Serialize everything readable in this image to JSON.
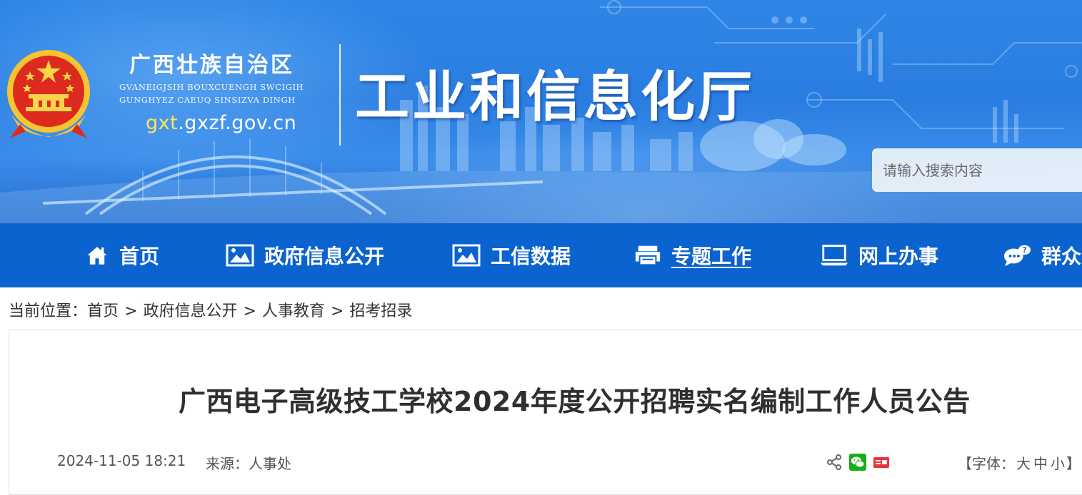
{
  "header": {
    "region_name_cn": "广西壮族自治区",
    "region_name_zhuang_line1": "GVANEIGJSIH BOUXCUENGH SWCIGIH",
    "region_name_zhuang_line2": "GUNGHYEZ CAEUQ SINSIZVA DINGH",
    "domain_prefix": "gxt",
    "domain_rest": ".gxzf.gov.cn",
    "department": "工业和信息化厅",
    "search_placeholder": "请输入搜索内容"
  },
  "nav": {
    "items": [
      {
        "label": "首页",
        "icon": "home-icon"
      },
      {
        "label": "政府信息公开",
        "icon": "picture-icon"
      },
      {
        "label": "工信数据",
        "icon": "picture-icon"
      },
      {
        "label": "专题工作",
        "icon": "printer-icon",
        "active": true
      },
      {
        "label": "网上办事",
        "icon": "monitor-icon"
      },
      {
        "label": "群众",
        "icon": "chat-icon"
      }
    ]
  },
  "breadcrumb": {
    "prefix": "当前位置：",
    "items": [
      "首页",
      "政府信息公开",
      "人事教育",
      "招考招录"
    ],
    "separator": ">"
  },
  "article": {
    "title": "广西电子高级技工学校2024年度公开招聘实名编制工作人员公告",
    "date": "2024-11-05 18:21",
    "source": "来源：人事处",
    "font_size": {
      "open": "【字体：",
      "large": "大",
      "medium": "中",
      "small": "小",
      "close": "】"
    }
  },
  "colors": {
    "nav_bg": "#0b63cf",
    "header_bg": "#2a7de0",
    "domain_highlight": "#ffe45c",
    "wechat": "#1aad19",
    "toutiao": "#e8333a"
  }
}
